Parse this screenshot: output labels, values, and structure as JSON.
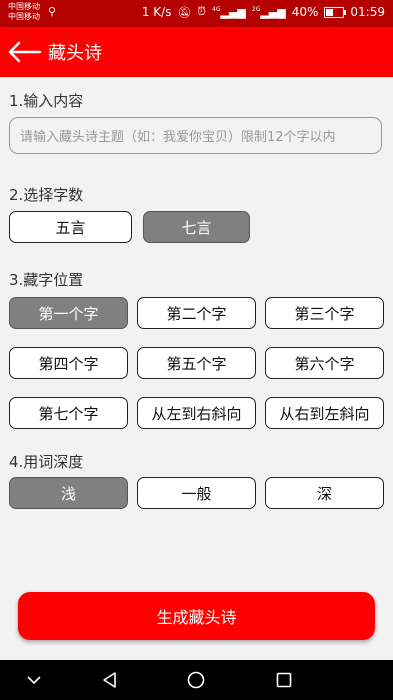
{
  "status_bar": {
    "carrier_1": "中国移动",
    "carrier_2": "中国移动",
    "network_speed": "1 K/s",
    "signal_1_label": "4G",
    "signal_2_label": "2G",
    "battery_percent": "40%",
    "time": "01:59"
  },
  "header": {
    "title": "藏头诗"
  },
  "section_input": {
    "label": "1.输入内容",
    "value": "",
    "placeholder": "请输入藏头诗主题（如：我爱你宝贝）限制12个字以内"
  },
  "section_wordcount": {
    "label": "2.选择字数",
    "options": [
      "五言",
      "七言"
    ],
    "selected": "七言"
  },
  "section_position": {
    "label": "3.藏字位置",
    "options": [
      "第一个字",
      "第二个字",
      "第三个字",
      "第四个字",
      "第五个字",
      "第六个字",
      "第七个字",
      "从左到右斜向",
      "从右到左斜向"
    ],
    "selected": "第一个字"
  },
  "section_depth": {
    "label": "4.用词深度",
    "options": [
      "浅",
      "一般",
      "深"
    ],
    "selected": "浅"
  },
  "generate_button": {
    "label": "生成藏头诗"
  },
  "colors": {
    "status_bar": "#b50000",
    "app_bar": "#ff0000",
    "primary_button": "#ff0000",
    "selected_option": "#808080"
  }
}
